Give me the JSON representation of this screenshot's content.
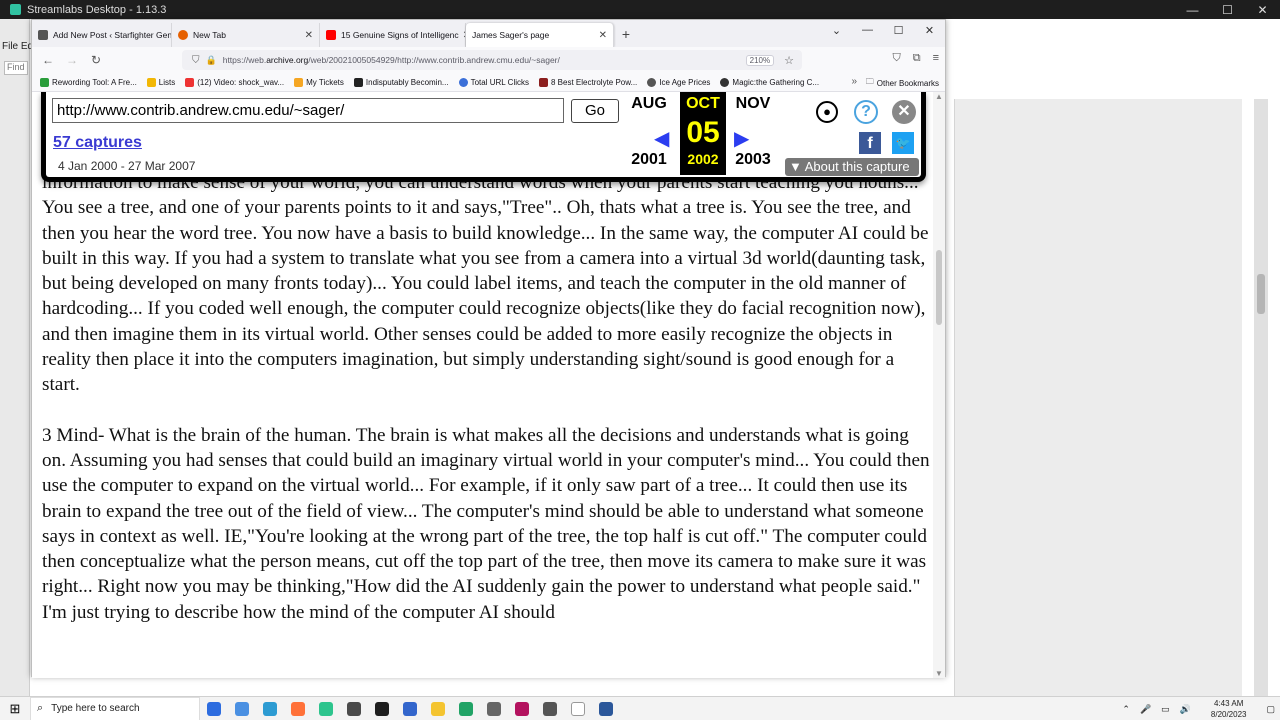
{
  "outer_window": {
    "title": "Streamlabs Desktop - 1.13.3",
    "controls": [
      "—",
      "☐",
      "✕"
    ]
  },
  "background_app": {
    "menu": "File  Ed",
    "find_label": "Find"
  },
  "browser": {
    "tabs": [
      {
        "label": "Add New Post ‹ Starfighter Gen",
        "favicon_color": "#555555",
        "active": false
      },
      {
        "label": "New Tab",
        "favicon_color": "#e66000",
        "active": false
      },
      {
        "label": "15 Genuine Signs of Intelligenc",
        "favicon_color": "#ff0000",
        "active": false
      },
      {
        "label": "James Sager's page",
        "favicon_color": "",
        "active": true
      }
    ],
    "new_tab": "+",
    "window_controls": [
      "⌄",
      "—",
      "☐",
      "✕"
    ],
    "url": {
      "prefix": "https://web.",
      "host": "archive.org",
      "suffix": "/web/20021005054929/http://www.contrib.andrew.cmu.edu/~sager/",
      "zoom": "210%"
    },
    "bookmarks": [
      {
        "label": "Rewording Tool: A Fre...",
        "color": "#2a9d3b"
      },
      {
        "label": "Lists",
        "color": "#f2b705"
      },
      {
        "label": "(12) Video: shock_wav...",
        "color": "#e33"
      },
      {
        "label": "My Tickets",
        "color": "#f5a623"
      },
      {
        "label": "Indisputably Becomin...",
        "color": "#222"
      },
      {
        "label": "Total URL Clicks",
        "color": "#3b6fd8"
      },
      {
        "label": "8 Best Electrolyte Pow...",
        "color": "#8b1e1e"
      },
      {
        "label": "Ice Age Prices",
        "color": "#555"
      },
      {
        "label": "Magic:the Gathering C...",
        "color": "#333"
      }
    ],
    "bookmarks_overflow": "»",
    "other_bookmarks": "Other Bookmarks"
  },
  "wayback": {
    "url_input": "http://www.contrib.andrew.cmu.edu/~sager/",
    "go_label": "Go",
    "captures": "57 captures",
    "date_range": "4 Jan 2000 - 27 Mar 2007",
    "prev_month": "AUG",
    "cur_month": "OCT",
    "next_month": "NOV",
    "prev_year": "2001",
    "cur_year": "2002",
    "next_year": "2003",
    "day": "05",
    "about": "About this capture"
  },
  "page": {
    "paragraph1": "information to make sense of your world, you can understand words when your parents start teaching you nouns... You see a tree, and one of your parents points to it and says,\"Tree\".. Oh, thats what a tree is. You see the tree, and then you hear the word tree. You now have a basis to build knowledge... In the same way, the computer AI could be built in this way. If you had a system to translate what you see from a camera into a virtual 3d world(daunting task, but being developed on many fronts today)... You could label items, and teach the computer in the old manner of hardcoding... If you coded well enough, the computer could recognize objects(like they do facial recognition now), and then imagine them in its virtual world. Other senses could be added to more easily recognize the objects in reality then place it into the computers imagination, but simply understanding sight/sound is good enough for a start.",
    "paragraph2": "3 Mind- What is the brain of the human. The brain is what makes all the decisions and understands what is going on. Assuming you had senses that could build an imaginary virtual world in your computer's mind... You could then use the computer to expand on the virtual world... For example, if it only saw part of a tree... It could then use its brain to expand the tree out of the field of view... The computer's mind should be able to understand what someone says in context as well. IE,\"You're looking at the wrong part of the tree, the top half is cut off.\" The computer could then conceptualize what the person means, cut off the top part of the tree, then move its camera to make sure it was right... Right now you may be thinking,\"How did the AI suddenly gain the power to understand what people said.\" I'm just trying to describe how the mind of the computer AI should"
  },
  "taskbar": {
    "search_placeholder": "Type here to search",
    "time": "4:43 AM",
    "date": "8/20/2023",
    "pinned_colors": [
      "#2d6cdf",
      "#4a90e2",
      "#2d9bd2",
      "#ff7139",
      "#2dc48d",
      "#4a4a4a",
      "#1e1e1e",
      "#3366cc",
      "#f4c430",
      "#21a366",
      "#666666",
      "#b3125e",
      "#555555",
      "#ffffff",
      "#2b579a"
    ]
  }
}
